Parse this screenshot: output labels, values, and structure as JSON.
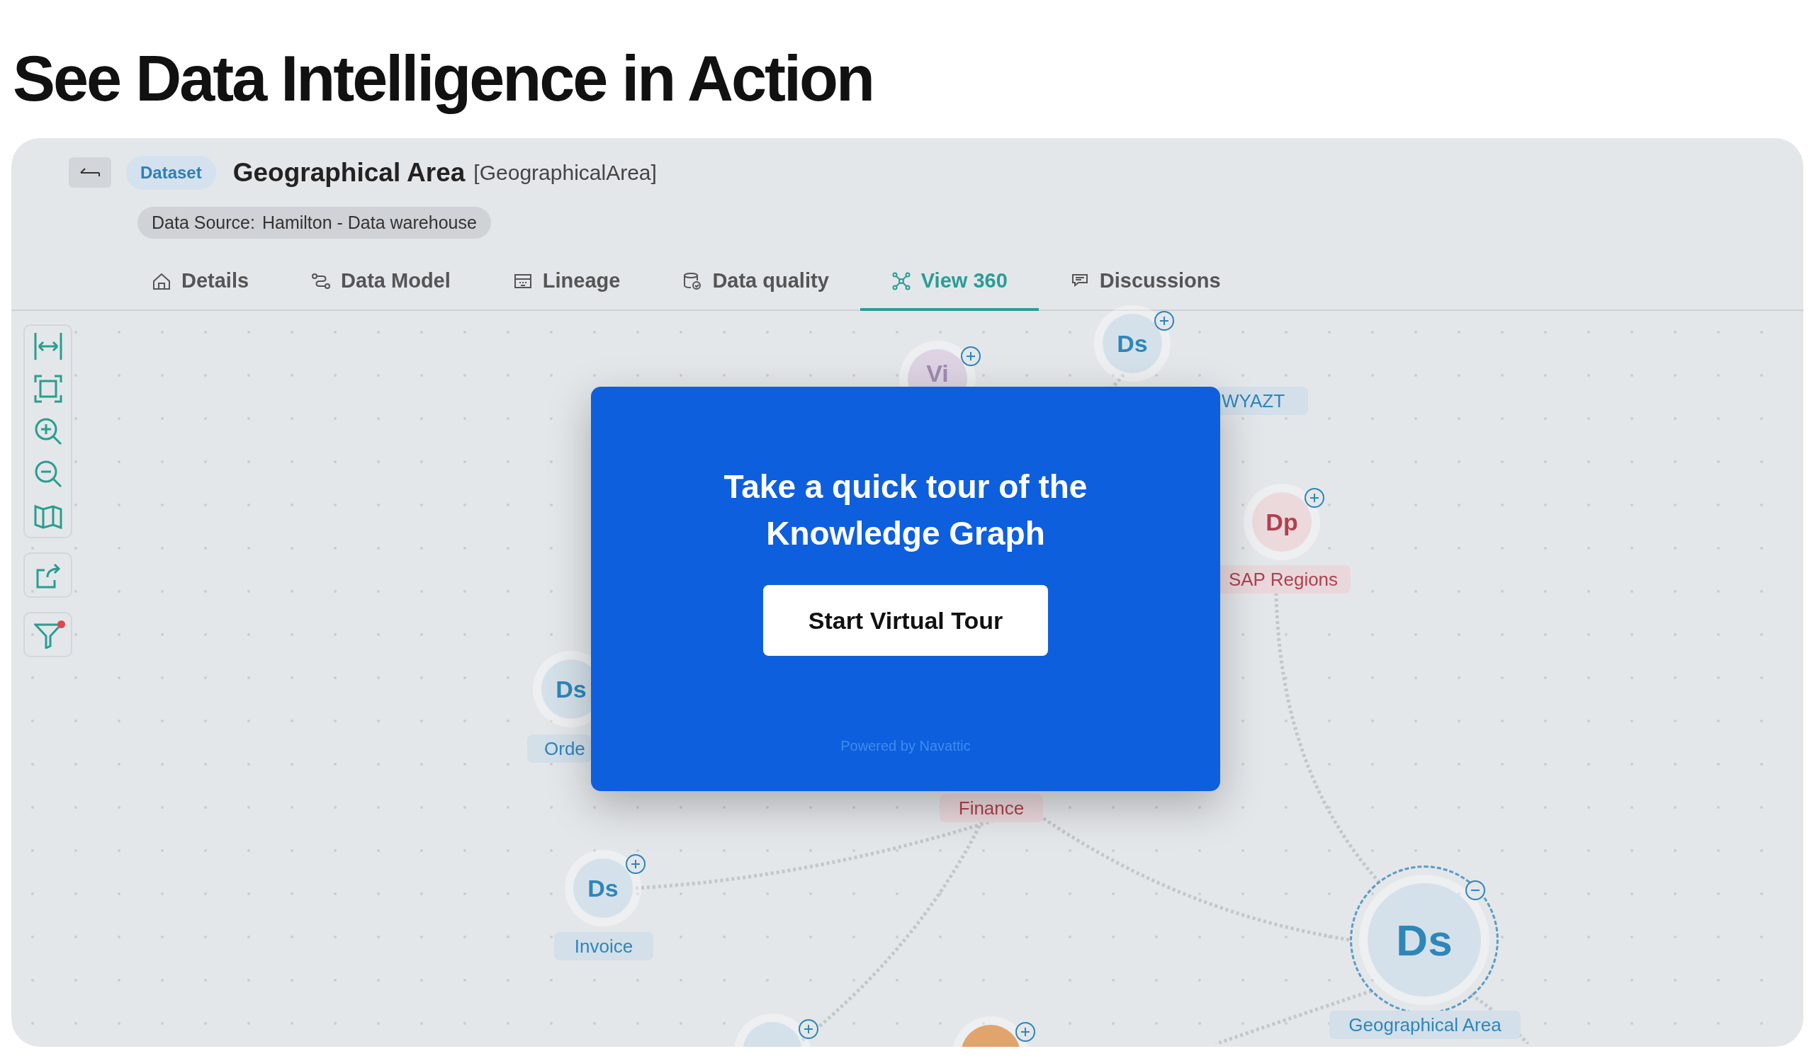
{
  "heading": "See Data Intelligence in Action",
  "asset": {
    "badge": "Dataset",
    "title": "Geographical Area",
    "technical_name": "[GeographicalArea]",
    "source_label": "Data Source:",
    "source_value": "Hamilton - Data warehouse"
  },
  "tabs": [
    {
      "label": "Details",
      "selected": false
    },
    {
      "label": "Data Model",
      "selected": false
    },
    {
      "label": "Lineage",
      "selected": false
    },
    {
      "label": "Data quality",
      "selected": false
    },
    {
      "label": "View 360",
      "selected": true
    },
    {
      "label": "Discussions",
      "selected": false
    }
  ],
  "toolbar": {
    "filter_active": true
  },
  "graph": {
    "nodes": [
      {
        "kind": "view",
        "abbr": "Vi",
        "expanded": false,
        "selected": false
      },
      {
        "kind": "dataset",
        "abbr": "Ds",
        "expanded": false,
        "selected": false
      },
      {
        "kind": "product",
        "abbr": "Dp",
        "expanded": false,
        "selected": false
      },
      {
        "kind": "dataset",
        "abbr": "Ds",
        "selected": false
      },
      {
        "kind": "dataset",
        "abbr": "Ds",
        "expanded": false,
        "selected": false
      },
      {
        "kind": "dataset",
        "abbr": "Ds",
        "expanded": true,
        "selected": true
      },
      {
        "kind": "dataset",
        "expanded": false,
        "selected": false
      },
      {
        "kind": "avatar",
        "expanded": false,
        "selected": false
      }
    ],
    "labels": [
      {
        "kind": "dataset",
        "text": "WYAZT"
      },
      {
        "kind": "product",
        "text": "SAP Regions"
      },
      {
        "kind": "dataset",
        "text": "Orde"
      },
      {
        "kind": "product",
        "text": "Finance"
      },
      {
        "kind": "dataset",
        "text": "Invoice"
      },
      {
        "kind": "dataset",
        "text": "Geographical Area"
      }
    ]
  },
  "tour": {
    "title": "Take a quick tour of the Knowledge Graph",
    "button": "Start Virtual Tour",
    "footer": "Powered by Navattic"
  }
}
